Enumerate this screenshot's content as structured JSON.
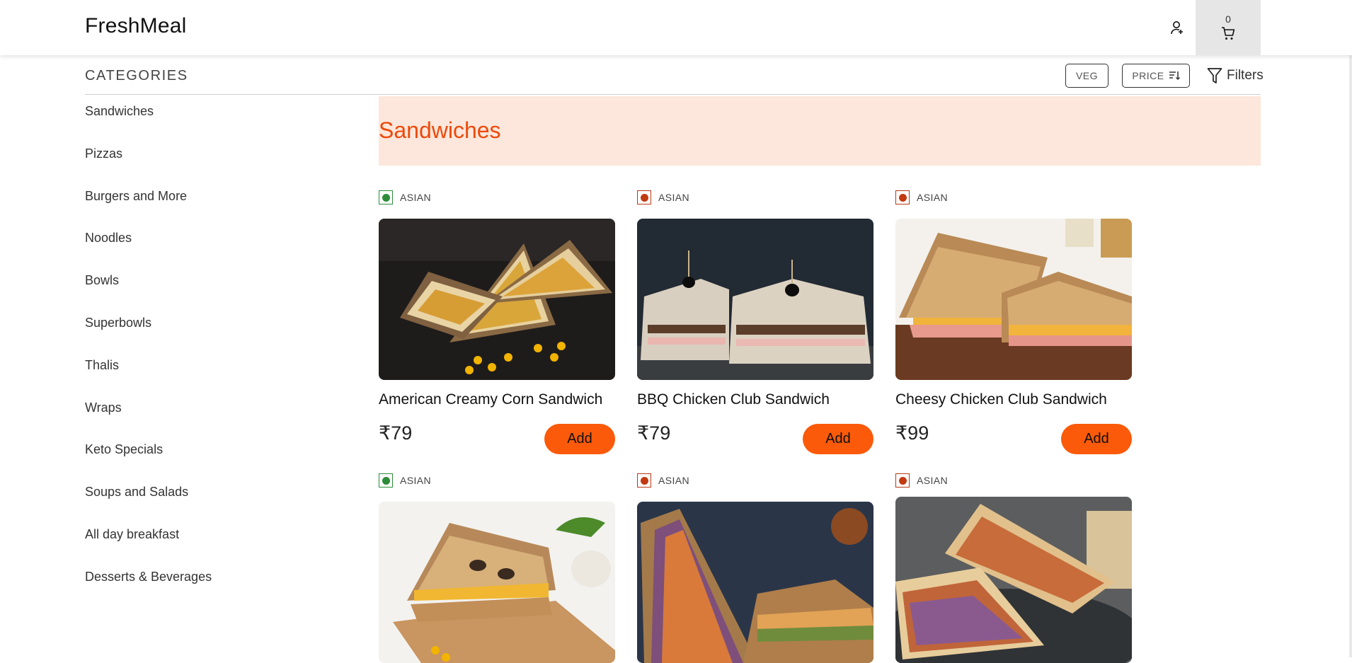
{
  "header": {
    "logo": "FreshMeal",
    "cart_count": "0"
  },
  "toolbar": {
    "title": "CATEGORIES",
    "veg_label": "VEG",
    "price_label": "PRICE",
    "filters_label": "Filters"
  },
  "sidebar": {
    "items": [
      "Sandwiches",
      "Pizzas",
      "Burgers and More",
      "Noodles",
      "Bowls",
      "Superbowls",
      "Thalis",
      "Wraps",
      "Keto Specials",
      "Soups and Salads",
      "All day breakfast",
      "Desserts & Beverages"
    ]
  },
  "section": {
    "title": "Sandwiches"
  },
  "products": [
    {
      "tag": "ASIAN",
      "diet": "veg",
      "name": "American Creamy Corn Sandwich",
      "price": "₹79",
      "add_label": "Add"
    },
    {
      "tag": "ASIAN",
      "diet": "non-veg",
      "name": "BBQ Chicken Club Sandwich",
      "price": "₹79",
      "add_label": "Add"
    },
    {
      "tag": "ASIAN",
      "diet": "non-veg",
      "name": "Cheesy Chicken Club Sandwich",
      "price": "₹99",
      "add_label": "Add"
    },
    {
      "tag": "ASIAN",
      "diet": "veg",
      "name": "",
      "price": "",
      "add_label": ""
    },
    {
      "tag": "ASIAN",
      "diet": "non-veg",
      "name": "",
      "price": "",
      "add_label": ""
    },
    {
      "tag": "ASIAN",
      "diet": "non-veg",
      "name": "",
      "price": "",
      "add_label": ""
    }
  ],
  "colors": {
    "accent": "#fa5a09",
    "banner_bg": "#fde6db",
    "banner_text": "#ec4a0b",
    "veg": "#2e8b3a",
    "non_veg": "#c13a10"
  }
}
